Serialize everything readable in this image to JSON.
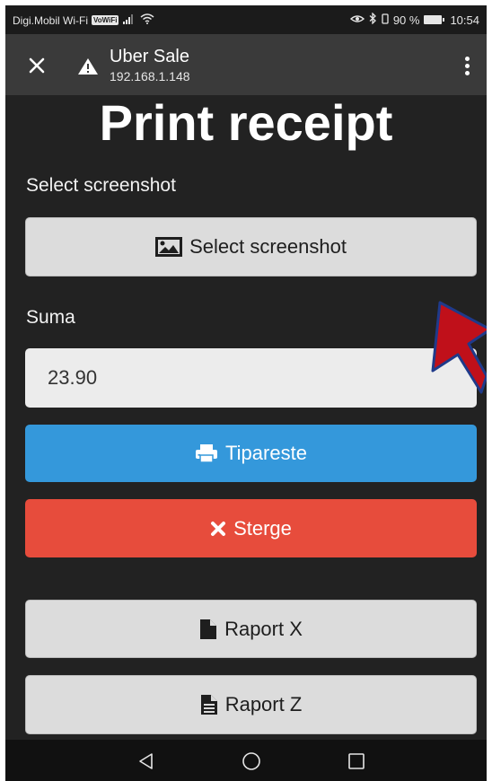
{
  "status_bar": {
    "carrier": "Digi.Mobil Wi-Fi",
    "volte_badge": "VoWiFi",
    "battery_text": "90 %",
    "time": "10:54"
  },
  "app_bar": {
    "title": "Uber Sale",
    "subtitle": "192.168.1.148",
    "close_icon": "close-icon",
    "menu_icon": "more-vert-icon"
  },
  "page": {
    "heading": "Print receipt",
    "screenshot_label": "Select screenshot",
    "screenshot_button": "Select screenshot",
    "amount_label": "Suma",
    "amount_value": "23.90",
    "print_button": "Tipareste",
    "delete_button": "Sterge",
    "report_x_button": "Raport X",
    "report_z_button": "Raport Z"
  },
  "colors": {
    "background": "#222222",
    "print_button": "#3498db",
    "delete_button": "#e74c3c",
    "light_button": "#dcdcdc",
    "annotation_arrow": "#c0101a"
  },
  "nav_bar": {
    "icons": [
      "back-icon",
      "home-icon",
      "recents-icon"
    ]
  }
}
